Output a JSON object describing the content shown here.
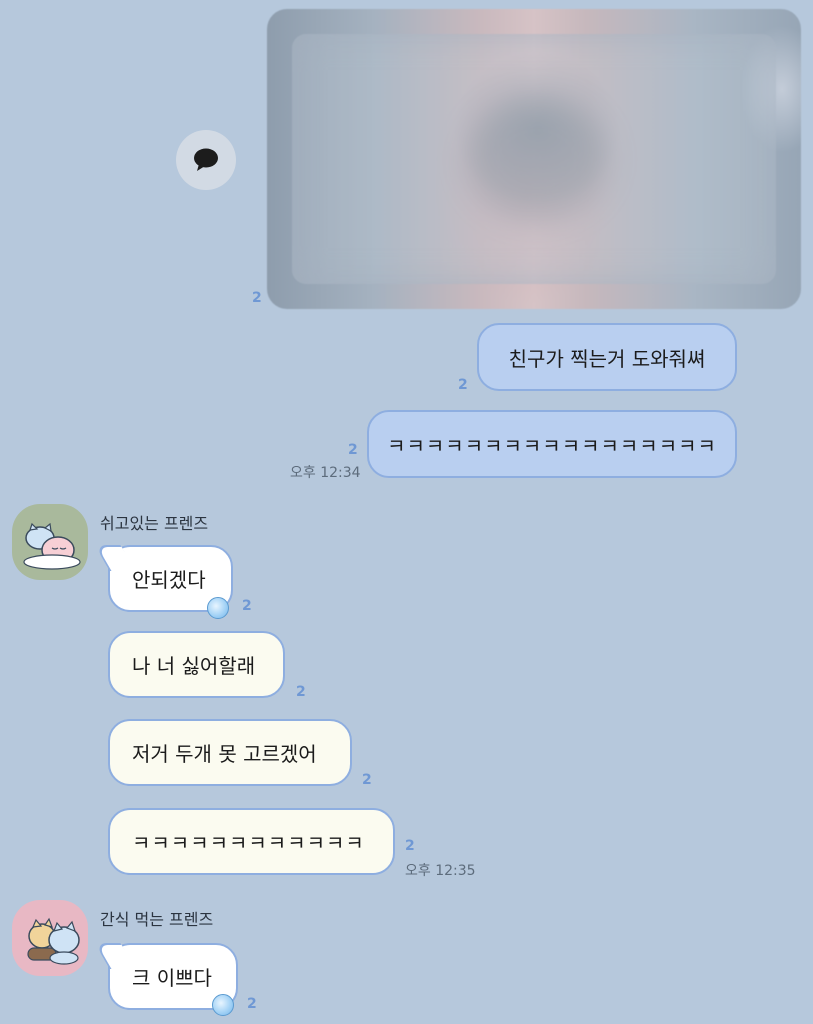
{
  "colors": {
    "background": "#b6c8dc",
    "my_bubble": "#b9cff0",
    "their_bubble": "#fbfbf0",
    "bubble_border": "#8eaee0",
    "unread_count": "#6f98d4"
  },
  "photo_message": {
    "unread": "2",
    "icon": "share-icon"
  },
  "my_messages": [
    {
      "text": "친구가 찍는거 도와줘쎠",
      "unread": "2"
    },
    {
      "text": "ㅋㅋㅋㅋㅋㅋㅋㅋㅋㅋㅋㅋㅋㅋㅋㅋㅋ",
      "unread": "2",
      "time": "오후 12:34"
    }
  ],
  "group1": {
    "sender": "쉬고있는 프렌즈",
    "avatar_icon": "sleeping-friends-avatar",
    "messages": [
      {
        "text": "안되겠다",
        "unread": "2"
      },
      {
        "text": "나 너 싫어할래",
        "unread": "2"
      },
      {
        "text": "저거 두개 못 고르겠어",
        "unread": "2"
      },
      {
        "text": "ㅋㅋㅋㅋㅋㅋㅋㅋㅋㅋㅋㅋ",
        "unread": "2",
        "time": "오후 12:35"
      }
    ]
  },
  "group2": {
    "sender": "간식 먹는 프렌즈",
    "avatar_icon": "snacking-friends-avatar",
    "messages": [
      {
        "text": "크 이쁘다",
        "unread": "2"
      }
    ]
  }
}
